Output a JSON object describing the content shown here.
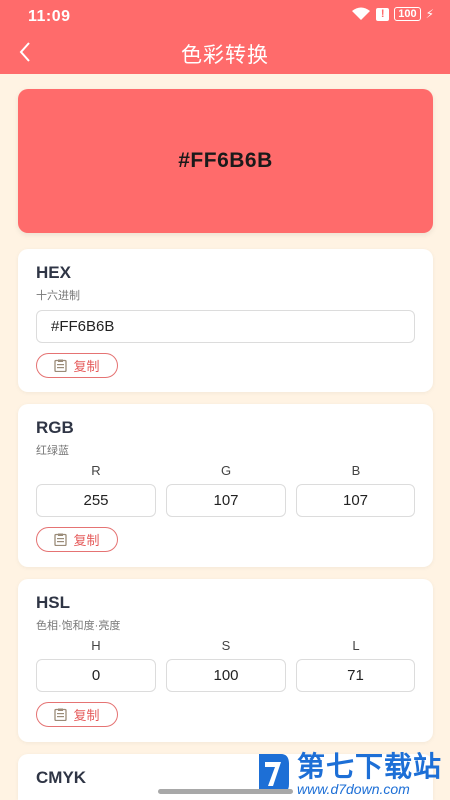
{
  "status_bar": {
    "time": "11:09",
    "battery": "100"
  },
  "header": {
    "title": "色彩转换"
  },
  "preview": {
    "hex": "#FF6B6B",
    "color": "#FF6B6B"
  },
  "hex_card": {
    "title": "HEX",
    "subtitle": "十六进制",
    "value": "#FF6B6B",
    "copy_label": "复制"
  },
  "rgb_card": {
    "title": "RGB",
    "subtitle": "红绿蓝",
    "columns": [
      {
        "label": "R",
        "value": "255"
      },
      {
        "label": "G",
        "value": "107"
      },
      {
        "label": "B",
        "value": "107"
      }
    ],
    "copy_label": "复制"
  },
  "hsl_card": {
    "title": "HSL",
    "subtitle": "色相·饱和度·亮度",
    "columns": [
      {
        "label": "H",
        "value": "0"
      },
      {
        "label": "S",
        "value": "100"
      },
      {
        "label": "L",
        "value": "71"
      }
    ],
    "copy_label": "复制"
  },
  "cmyk_card": {
    "title": "CMYK"
  },
  "watermark": {
    "name": "第七下载站",
    "url": "www.d7down.com"
  },
  "colors": {
    "accent": "#FF6B6B",
    "background": "#FFF3E3",
    "button_border": "#E57373",
    "watermark": "#1d6fd6"
  },
  "icons": {
    "back": "chevron-left-icon",
    "copy": "clipboard-icon",
    "wifi": "wifi-icon",
    "alert": "alert-icon",
    "battery": "battery-icon",
    "charging": "bolt-icon"
  }
}
